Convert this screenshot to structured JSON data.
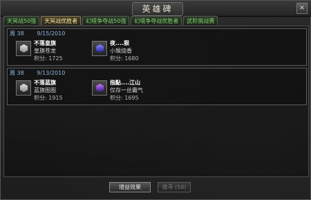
{
  "window": {
    "title": "英雄碑",
    "close_label": "×"
  },
  "tabs": [
    {
      "label": "天冥战50强"
    },
    {
      "label": "天冥战优胜者"
    },
    {
      "label": "幻境争夺战50强"
    },
    {
      "label": "幻境争夺战优胜者"
    },
    {
      "label": "武阶挑战赛"
    }
  ],
  "entries": [
    {
      "week": "周 38",
      "date": "9/15/2010",
      "winners": [
        {
          "name": "不落皇旗",
          "guild": "皇旗苍龙",
          "score": "积分: 1725",
          "emblem": "silver-emblem-icon"
        },
        {
          "name": "夜....狠",
          "guild": "小猴烧香",
          "score": "积分: 1680",
          "emblem": "blue-emblem-icon"
        }
      ]
    },
    {
      "week": "周 38",
      "date": "9/13/2010",
      "winners": [
        {
          "name": "不落蓝旗",
          "guild": "蓝旗图图",
          "score": "积分: 1915",
          "emblem": "silver-emblem-icon"
        },
        {
          "name": "指點....江山",
          "guild": "仅存一丝霸气",
          "score": "积分: 1695",
          "emblem": "purple-emblem-icon"
        }
      ]
    }
  ],
  "footer": {
    "bonus_button": "增益效果",
    "search_button": "搜寻 (58)"
  }
}
